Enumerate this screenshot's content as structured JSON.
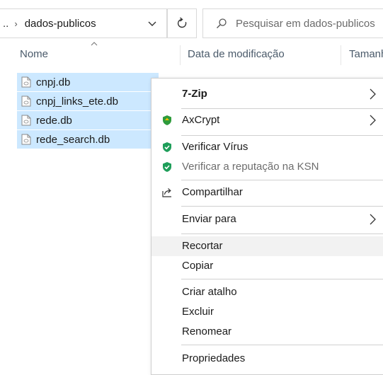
{
  "addressbar": {
    "overflow": "..",
    "separator": "›",
    "current_folder": "dados-publicos"
  },
  "search": {
    "placeholder": "Pesquisar em dados-publicos"
  },
  "columns": {
    "name": "Nome",
    "modified": "Data de modificação",
    "size": "Tamanh"
  },
  "files": [
    {
      "name": "cnpj.db"
    },
    {
      "name": "cnpj_links_ete.db"
    },
    {
      "name": "rede.db"
    },
    {
      "name": "rede_search.db"
    }
  ],
  "menu": {
    "items": [
      {
        "label": "7-Zip",
        "icon": "none",
        "submenu": true
      },
      {
        "label": "AxCrypt",
        "icon": "axcrypt-shield-icon",
        "submenu": true
      },
      {
        "label": "Verificar Vírus",
        "icon": "kaspersky-shield-icon"
      },
      {
        "label": "Verificar a reputação na KSN",
        "icon": "kaspersky-shield-icon"
      },
      {
        "label": "Compartilhar",
        "icon": "share-icon"
      },
      {
        "label": "Enviar para",
        "icon": "none",
        "submenu": true
      },
      {
        "label": "Recortar"
      },
      {
        "label": "Copiar"
      },
      {
        "label": "Criar atalho"
      },
      {
        "label": "Excluir"
      },
      {
        "label": "Renomear"
      },
      {
        "label": "Propriedades"
      }
    ]
  },
  "colors": {
    "selection": "#cce8ff",
    "axcrypt_green": "#2e9b3c",
    "kaspersky_green": "#1f9e5a",
    "menu_hover": "#f2f2f2"
  }
}
